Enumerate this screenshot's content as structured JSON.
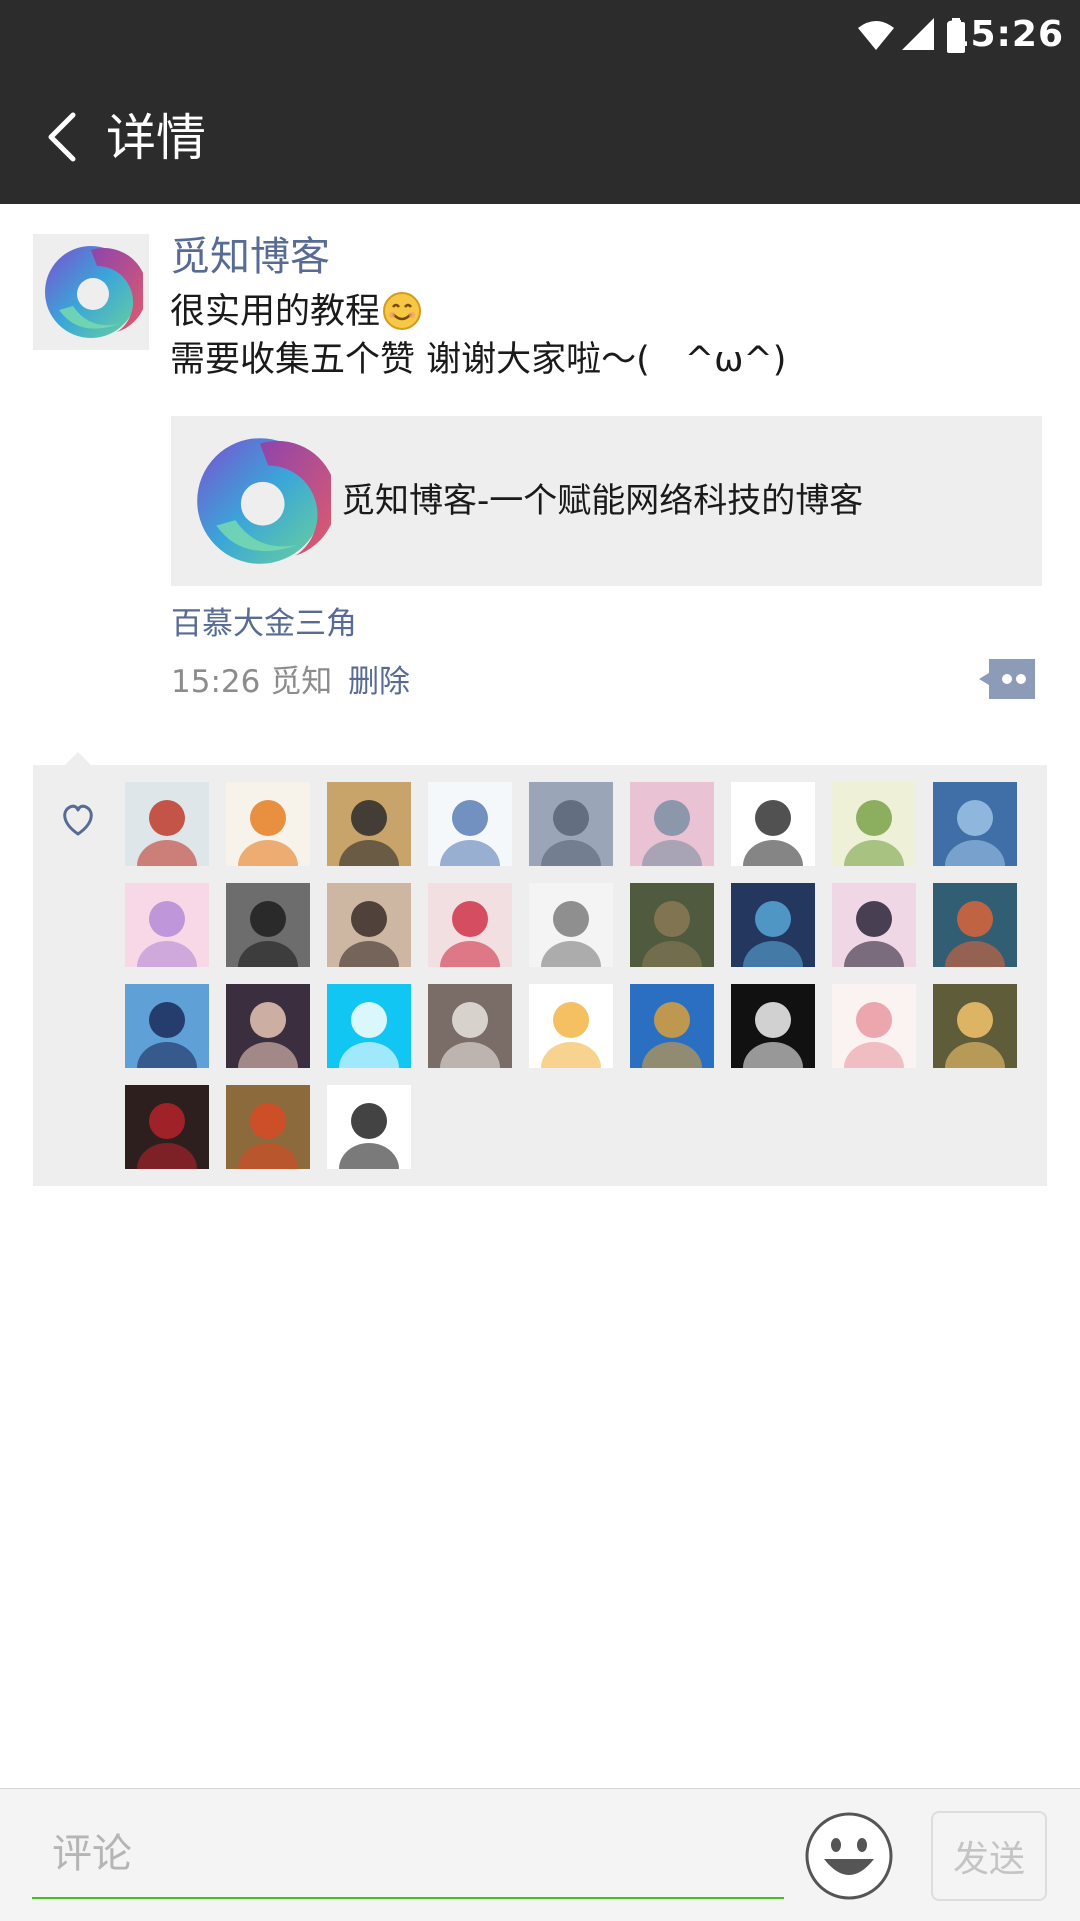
{
  "status_bar": {
    "time": "15:26",
    "icons": [
      "wifi-icon",
      "cell-signal-icon",
      "battery-icon"
    ]
  },
  "header": {
    "title": "详情",
    "back_icon": "chevron-left-icon"
  },
  "post": {
    "author": "觅知博客",
    "text_line1": "很实用的教程",
    "text_emoji": "smile-emoji-icon",
    "text_line2": "需要收集五个赞 谢谢大家啦～(　^ω^)",
    "link_card": {
      "title": "觅知博客-一个赋能网络科技的博客"
    },
    "location": "百慕大金三角",
    "time": "15:26",
    "source": "觅知",
    "delete_label": "删除",
    "comment_button_icon": "comment-dots-icon"
  },
  "likes": {
    "icon": "heart-outline-icon",
    "count": 30,
    "avatar_colors": [
      [
        "#dfe6ea",
        "#c0392b"
      ],
      [
        "#f7f2ea",
        "#e67e22"
      ],
      [
        "#c8a46a",
        "#2b2b2b"
      ],
      [
        "#f5f8fb",
        "#5b7fb5"
      ],
      [
        "#9aa5b8",
        "#5a6477"
      ],
      [
        "#e9c3d3",
        "#7d8fa3"
      ],
      [
        "#ffffff",
        "#333333"
      ],
      [
        "#eef1d8",
        "#7aa34a"
      ],
      [
        "#3f6fa6",
        "#9ec4e8"
      ],
      [
        "#f8d7e6",
        "#b58bd6"
      ],
      [
        "#6d6d6d",
        "#1e1e1e"
      ],
      [
        "#cdb7a3",
        "#3a2d28"
      ],
      [
        "#f2dfe2",
        "#d0344a"
      ],
      [
        "#f4f4f4",
        "#7c7c7c"
      ],
      [
        "#4f5a3f",
        "#8a7a55"
      ],
      [
        "#24375f",
        "#58a7d6"
      ],
      [
        "#f0d7e6",
        "#2c2437"
      ],
      [
        "#315e73",
        "#d9643a"
      ],
      [
        "#5fa0d6",
        "#1a2c5a"
      ],
      [
        "#3b2e3f",
        "#e8c4b5"
      ],
      [
        "#12c6f4",
        "#ffffff"
      ],
      [
        "#7a6c66",
        "#e9e4df"
      ],
      [
        "#ffffff",
        "#f2b545"
      ],
      [
        "#2a6fc2",
        "#d7a03a"
      ],
      [
        "#111111",
        "#f3f3f3"
      ],
      [
        "#fbf2f2",
        "#e89aa1"
      ],
      [
        "#5f5c3a",
        "#f2c36b"
      ],
      [
        "#2e1f1f",
        "#b3232c"
      ],
      [
        "#8c6a3b",
        "#d84a25"
      ],
      [
        "#ffffff",
        "#222222"
      ]
    ]
  },
  "comment_bar": {
    "placeholder": "评论",
    "emoji_icon": "smiley-face-icon",
    "send_label": "发送"
  }
}
